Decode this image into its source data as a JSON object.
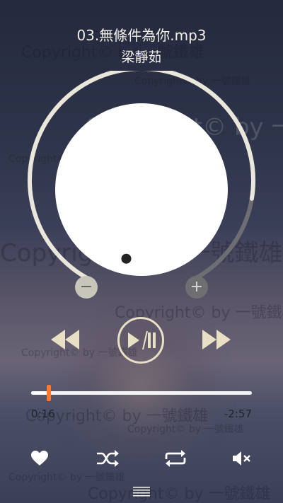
{
  "now_playing": {
    "title": "03.無條件為你.mp3",
    "artist": "梁靜茹"
  },
  "volume": {
    "level": 0.83,
    "minus_label": "−",
    "plus_label": "+"
  },
  "transport": {
    "rewind_icon": "rewind-icon",
    "play_pause_icon": "play-pause-icon",
    "forward_icon": "fast-forward-icon"
  },
  "progress": {
    "fraction": 0.08,
    "elapsed": "0:16",
    "remaining": "-2:57"
  },
  "bottom_bar": {
    "favorite_icon": "heart-icon",
    "shuffle_icon": "shuffle-icon",
    "repeat_icon": "repeat-icon",
    "mute_icon": "mute-icon",
    "menu_icon": "menu-icon"
  },
  "watermark_text": "Copyright©  by 一號鐵雄",
  "colors": {
    "accent_thumb": "#ff7a2e",
    "control_cream": "#e8e0c4",
    "arc_active": "#e9e6dc",
    "arc_inactive": "#6e6e72"
  }
}
